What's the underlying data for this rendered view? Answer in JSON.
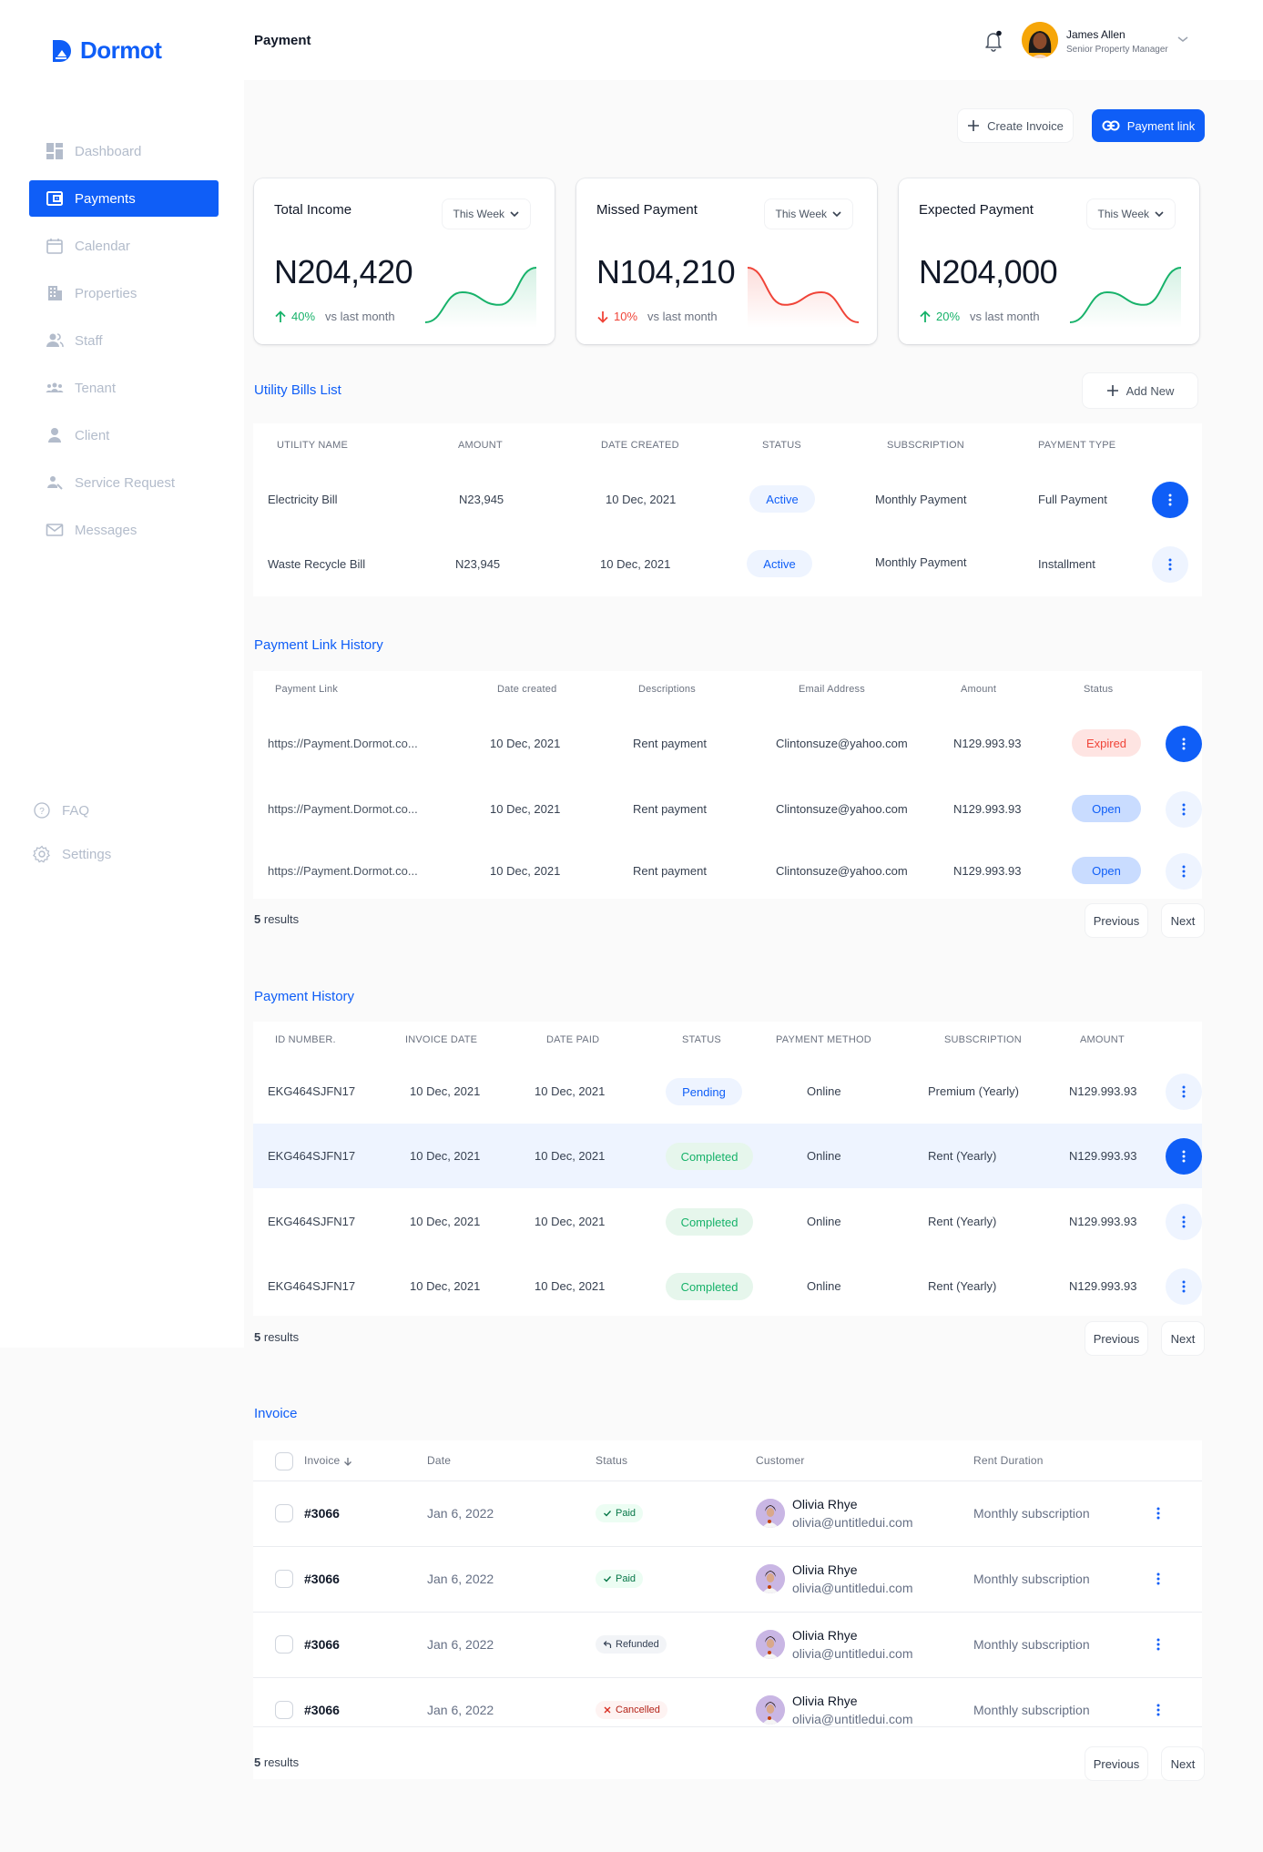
{
  "brand": {
    "name": "Dormot",
    "color": "#0f5ef7"
  },
  "header": {
    "title": "Payment",
    "user": {
      "name": "James Allen",
      "role": "Senior Property Manager"
    },
    "notification_icon": "bell-icon",
    "has_unread": true
  },
  "sidebar": {
    "items": [
      {
        "label": "Dashboard",
        "icon": "dashboard-icon",
        "active": false
      },
      {
        "label": "Payments",
        "icon": "wallet-icon",
        "active": true
      },
      {
        "label": "Calendar",
        "icon": "calendar-icon",
        "active": false
      },
      {
        "label": "Properties",
        "icon": "building-icon",
        "active": false
      },
      {
        "label": "Staff",
        "icon": "staff-icon",
        "active": false
      },
      {
        "label": "Tenant",
        "icon": "tenant-icon",
        "active": false
      },
      {
        "label": "Client",
        "icon": "user-icon",
        "active": false
      },
      {
        "label": "Service Request",
        "icon": "service-request-icon",
        "active": false
      },
      {
        "label": "Messages",
        "icon": "mail-icon",
        "active": false
      }
    ],
    "footer": [
      {
        "label": "FAQ",
        "icon": "help-circle-icon"
      },
      {
        "label": "Settings",
        "icon": "gear-icon"
      }
    ]
  },
  "actions": {
    "create_invoice": "Create Invoice",
    "payment_link": "Payment link"
  },
  "stats": [
    {
      "title": "Total Income",
      "period": "This Week",
      "value": "N204,420",
      "change": "40%",
      "direction": "up",
      "compare": "vs last month",
      "color": "#17b26a",
      "trend": [
        0,
        0.55,
        0.32,
        1.0
      ]
    },
    {
      "title": "Missed Payment",
      "period": "This Week",
      "value": "N104,210",
      "change": "10%",
      "direction": "down",
      "compare": "vs last month",
      "color": "#f04438",
      "trend": [
        1.0,
        0.32,
        0.55,
        0
      ]
    },
    {
      "title": "Expected Payment",
      "period": "This Week",
      "value": "N204,000",
      "change": "20%",
      "direction": "up",
      "compare": "vs last month",
      "color": "#17b26a",
      "trend": [
        0,
        0.55,
        0.32,
        1.0
      ]
    }
  ],
  "utility": {
    "title": "Utility Bills List",
    "add_label": "Add New",
    "columns": [
      "UTILITY NAME",
      "AMOUNT",
      "DATE CREATED",
      "STATUS",
      "SUBSCRIPTION",
      "PAYMENT TYPE"
    ],
    "rows": [
      {
        "name": "Electricity Bill",
        "amount": "N23,945",
        "date": "10 Dec, 2021",
        "status": "Active",
        "subscription": "Monthly Payment",
        "type": "Full Payment",
        "selected": true
      },
      {
        "name": "Waste Recycle Bill",
        "amount": "N23,945",
        "date": "10 Dec, 2021",
        "status": "Active",
        "subscription": "Monthly Payment",
        "type": "Installment",
        "selected": false
      }
    ]
  },
  "links": {
    "title": "Payment Link History",
    "columns": [
      "Payment Link",
      "Date created",
      "Descriptions",
      "Email Address",
      "Amount",
      "Status"
    ],
    "rows": [
      {
        "link": "https://Payment.Dormot.co...",
        "date": "10 Dec, 2021",
        "desc": "Rent payment",
        "email": "Clintonsuze@yahoo.com",
        "amount": "N129.993.93",
        "status": "Expired",
        "selected": true
      },
      {
        "link": "https://Payment.Dormot.co...",
        "date": "10 Dec, 2021",
        "desc": "Rent payment",
        "email": "Clintonsuze@yahoo.com",
        "amount": "N129.993.93",
        "status": "Open",
        "selected": false
      },
      {
        "link": "https://Payment.Dormot.co...",
        "date": "10 Dec, 2021",
        "desc": "Rent payment",
        "email": "Clintonsuze@yahoo.com",
        "amount": "N129.993.93",
        "status": "Open",
        "selected": false
      }
    ],
    "results_count": "5",
    "results_label": "results",
    "prev": "Previous",
    "next": "Next"
  },
  "history": {
    "title": "Payment History",
    "columns": [
      "ID NUMBER.",
      "INVOICE DATE",
      "DATE PAID",
      "STATUS",
      "PAYMENT METHOD",
      "SUBSCRIPTION",
      "AMOUNT"
    ],
    "rows": [
      {
        "id": "EKG464SJFN17",
        "invoice_date": "10 Dec, 2021",
        "paid": "10 Dec, 2021",
        "status": "Pending",
        "method": "Online",
        "subscription": "Premium (Yearly)",
        "amount": "N129.993.93",
        "selected": false
      },
      {
        "id": "EKG464SJFN17",
        "invoice_date": "10 Dec, 2021",
        "paid": "10 Dec, 2021",
        "status": "Completed",
        "method": "Online",
        "subscription": "Rent (Yearly)",
        "amount": "N129.993.93",
        "selected": true
      },
      {
        "id": "EKG464SJFN17",
        "invoice_date": "10 Dec, 2021",
        "paid": "10 Dec, 2021",
        "status": "Completed",
        "method": "Online",
        "subscription": "Rent (Yearly)",
        "amount": "N129.993.93",
        "selected": false
      },
      {
        "id": "EKG464SJFN17",
        "invoice_date": "10 Dec, 2021",
        "paid": "10 Dec, 2021",
        "status": "Completed",
        "method": "Online",
        "subscription": "Rent (Yearly)",
        "amount": "N129.993.93",
        "selected": false
      }
    ],
    "results_count": "5",
    "results_label": "results",
    "prev": "Previous",
    "next": "Next"
  },
  "invoice": {
    "title": "Invoice",
    "columns": [
      "Invoice",
      "Date",
      "Status",
      "Customer",
      "Rent Duration"
    ],
    "rows": [
      {
        "number": "#3066",
        "date": "Jan 6, 2022",
        "status": "Paid",
        "status_icon": "check-icon",
        "customer": "Olivia Rhye",
        "email": "olivia@untitledui.com",
        "duration": "Monthly subscription"
      },
      {
        "number": "#3066",
        "date": "Jan 6, 2022",
        "status": "Paid",
        "status_icon": "check-icon",
        "customer": "Olivia Rhye",
        "email": "olivia@untitledui.com",
        "duration": "Monthly subscription"
      },
      {
        "number": "#3066",
        "date": "Jan 6, 2022",
        "status": "Refunded",
        "status_icon": "undo-icon",
        "customer": "Olivia Rhye",
        "email": "olivia@untitledui.com",
        "duration": "Monthly subscription"
      },
      {
        "number": "#3066",
        "date": "Jan 6, 2022",
        "status": "Cancelled",
        "status_icon": "x-icon",
        "customer": "Olivia Rhye",
        "email": "olivia@untitledui.com",
        "duration": "Monthly subscription"
      }
    ],
    "results_count": "5",
    "results_label": "results",
    "prev": "Previous",
    "next": "Next"
  }
}
